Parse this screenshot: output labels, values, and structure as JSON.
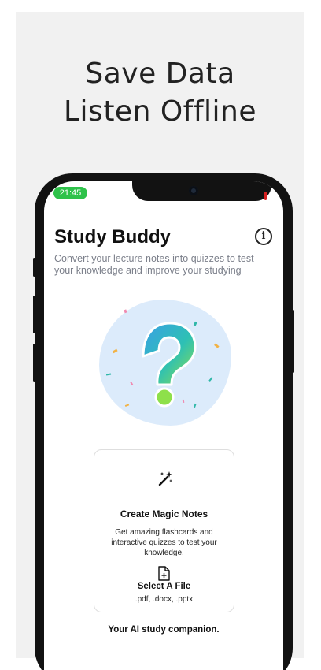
{
  "promo": {
    "headline_line1": "Save Data",
    "headline_line2": "Listen Offline"
  },
  "status_bar": {
    "time": "21:45"
  },
  "app": {
    "title": "Study Buddy",
    "info_icon": "i",
    "subtitle": "Convert your lecture notes into quizzes to test your knowledge and improve your studying"
  },
  "hero": {
    "icon": "question-mark-illustration"
  },
  "magic_card": {
    "icon": "magic-wand-icon",
    "title": "Create Magic Notes",
    "description": "Get amazing flashcards and interactive quizzes to test your knowledge.",
    "select_icon": "file-plus-icon",
    "select_label": "Select A File",
    "file_types": ".pdf, .docx, .pptx"
  },
  "tagline": "Your AI study companion.",
  "colors": {
    "panel_bg": "#f1f1f1",
    "status_green": "#2ec24a",
    "blob_blue": "#dcebfb",
    "subtitle_gray": "#7b7f8a"
  }
}
